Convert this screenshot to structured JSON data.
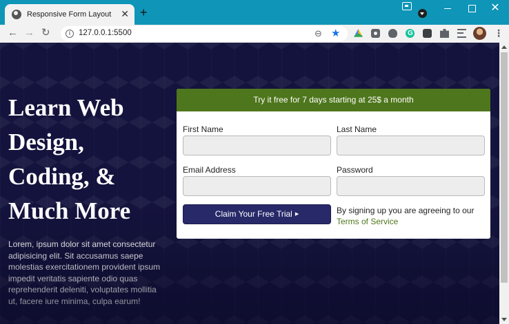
{
  "browser": {
    "tab_title": "Responsive Form Layout",
    "new_tab": "+",
    "url": "127.0.0.1:5500",
    "icons": [
      "globe-icon",
      "close-icon",
      "plus-icon",
      "back-icon",
      "forward-icon",
      "reload-icon",
      "info-icon",
      "zoom-icon",
      "star-icon",
      "drive-icon",
      "camera-icon",
      "bug-icon",
      "grammarly-icon",
      "box-icon",
      "puzzle-icon",
      "reading-list-icon",
      "avatar",
      "kebab-icon"
    ]
  },
  "page": {
    "heading": "Learn Web Design, Coding, & Much More",
    "description": "Lorem, ipsum dolor sit amet consectetur adipisicing elit. Sit accusamus saepe molestias exercitationem provident ipsum impedit veritatis sapiente odio quas reprehenderit deleniti, voluptates mollitia ut, facere iure minima, culpa earum!"
  },
  "form": {
    "banner": "Try it free for 7 days starting at 25$ a month",
    "first_name_label": "First Name",
    "last_name_label": "Last Name",
    "email_label": "Email Address",
    "password_label": "Password",
    "submit_label": "Claim Your Free Trial",
    "submit_arrow": "▶",
    "terms_prefix": "By signing up you are agreeing to our",
    "terms_link": "Terms of Service"
  },
  "colors": {
    "banner_green": "#4e761c",
    "button_navy": "#272969",
    "background_navy": "#14133d",
    "chrome_teal": "#0e95b8"
  }
}
